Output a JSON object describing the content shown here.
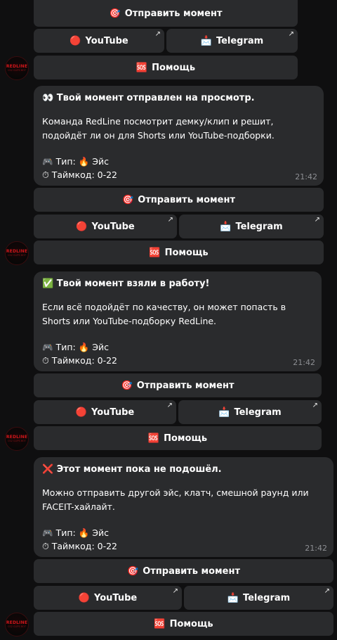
{
  "common": {
    "submit_icon": "🎯",
    "submit_label": "Отправить момент",
    "youtube_icon": "🔴",
    "youtube_label": "YouTube",
    "telegram_icon": "📩",
    "telegram_label": "Telegram",
    "help_icon": "🆘",
    "help_label": "Помощь",
    "external_icon": "↗",
    "bot_avatar_text": "REDLINE",
    "bot_avatar_subtext": "CS2 CLIPS BOT"
  },
  "messages": [
    {
      "title_icon": "👀",
      "title": "Твой момент отправлен на просмотр.",
      "body": "Команда RedLine посмотрит демку/клип и решит, подойдёт ли он для Shorts или YouTube-подборки.",
      "type_icon": "🎮",
      "type_label": "Тип:",
      "type_value_icon": "🔥",
      "type_value": "Эйс",
      "timecode_icon": "⏱",
      "timecode_label": "Таймкод:",
      "timecode_value": "0-22",
      "time": "21:42"
    },
    {
      "title_icon": "✅",
      "title": "Твой момент взяли в работу!",
      "body": "Если всё подойдёт по качеству, он может попасть в Shorts или YouTube-подборку RedLine.",
      "type_icon": "🎮",
      "type_label": "Тип:",
      "type_value_icon": "🔥",
      "type_value": "Эйс",
      "timecode_icon": "⏱",
      "timecode_label": "Таймкод:",
      "timecode_value": "0-22",
      "time": "21:42"
    },
    {
      "title_icon": "❌",
      "title": "Этот момент пока не подошёл.",
      "body": "Можно отправить другой эйс, клатч, смешной раунд или FACEIT-хайлайт.",
      "type_icon": "🎮",
      "type_label": "Тип:",
      "type_value_icon": "🔥",
      "type_value": "Эйс",
      "timecode_icon": "⏱",
      "timecode_label": "Таймкод:",
      "timecode_value": "0-22",
      "time": "21:42"
    }
  ]
}
